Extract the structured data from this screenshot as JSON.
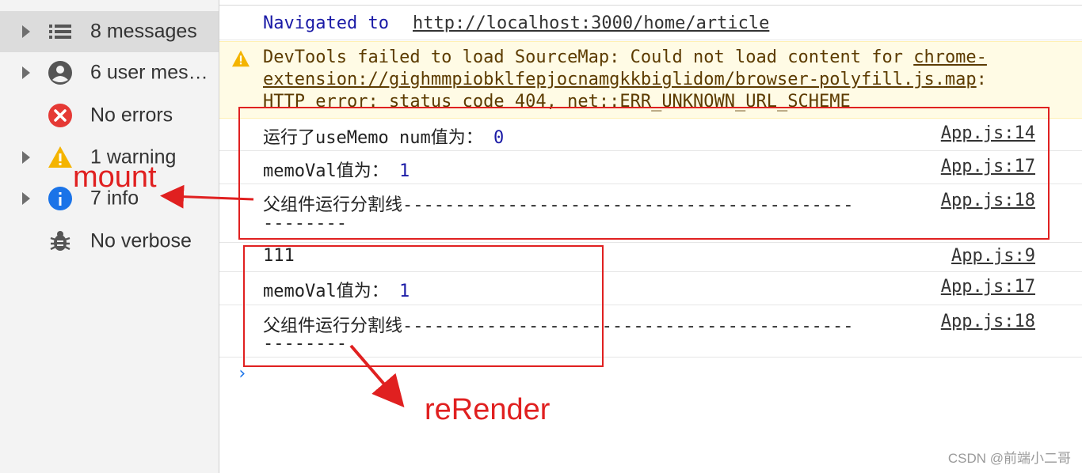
{
  "sidebar": {
    "items": [
      {
        "label": "8 messages",
        "icon": "list-icon"
      },
      {
        "label": "6 user messages",
        "icon": "user-icon"
      },
      {
        "label": "No errors",
        "icon": "error-icon"
      },
      {
        "label": "1 warning",
        "icon": "warning-icon"
      },
      {
        "label": "7 info",
        "icon": "info-icon"
      },
      {
        "label": "No verbose",
        "icon": "bug-icon"
      }
    ]
  },
  "console": {
    "nav": {
      "prefix": "Navigated to",
      "url": "http://localhost:3000/home/article"
    },
    "warning": {
      "text": "DevTools failed to load SourceMap: Could not load content for ",
      "link": "chrome-extension://gighmmpiobklfepjocnamgkkbiglidom/browser-polyfill.js.map",
      "rest": ": HTTP error: status code 404, net::ERR_UNKNOWN_URL_SCHEME"
    },
    "logs": [
      {
        "text": "运行了useMemo num值为： ",
        "value": "0",
        "source": "App.js:14"
      },
      {
        "text": "memoVal值为： ",
        "value": "1",
        "source": "App.js:17"
      },
      {
        "text": "父组件运行分割线-------------------------------------------",
        "text2": "--------",
        "source": "App.js:18"
      },
      {
        "text": "111",
        "source": "App.js:9"
      },
      {
        "text": "memoVal值为： ",
        "value": "1",
        "source": "App.js:17"
      },
      {
        "text": "父组件运行分割线-------------------------------------------",
        "text2": "--------",
        "source": "App.js:18"
      }
    ],
    "prompt": "›"
  },
  "annotations": {
    "mount": "mount",
    "rerender": "reRender",
    "color": "#e02020"
  },
  "watermark": "CSDN @前端小二哥"
}
